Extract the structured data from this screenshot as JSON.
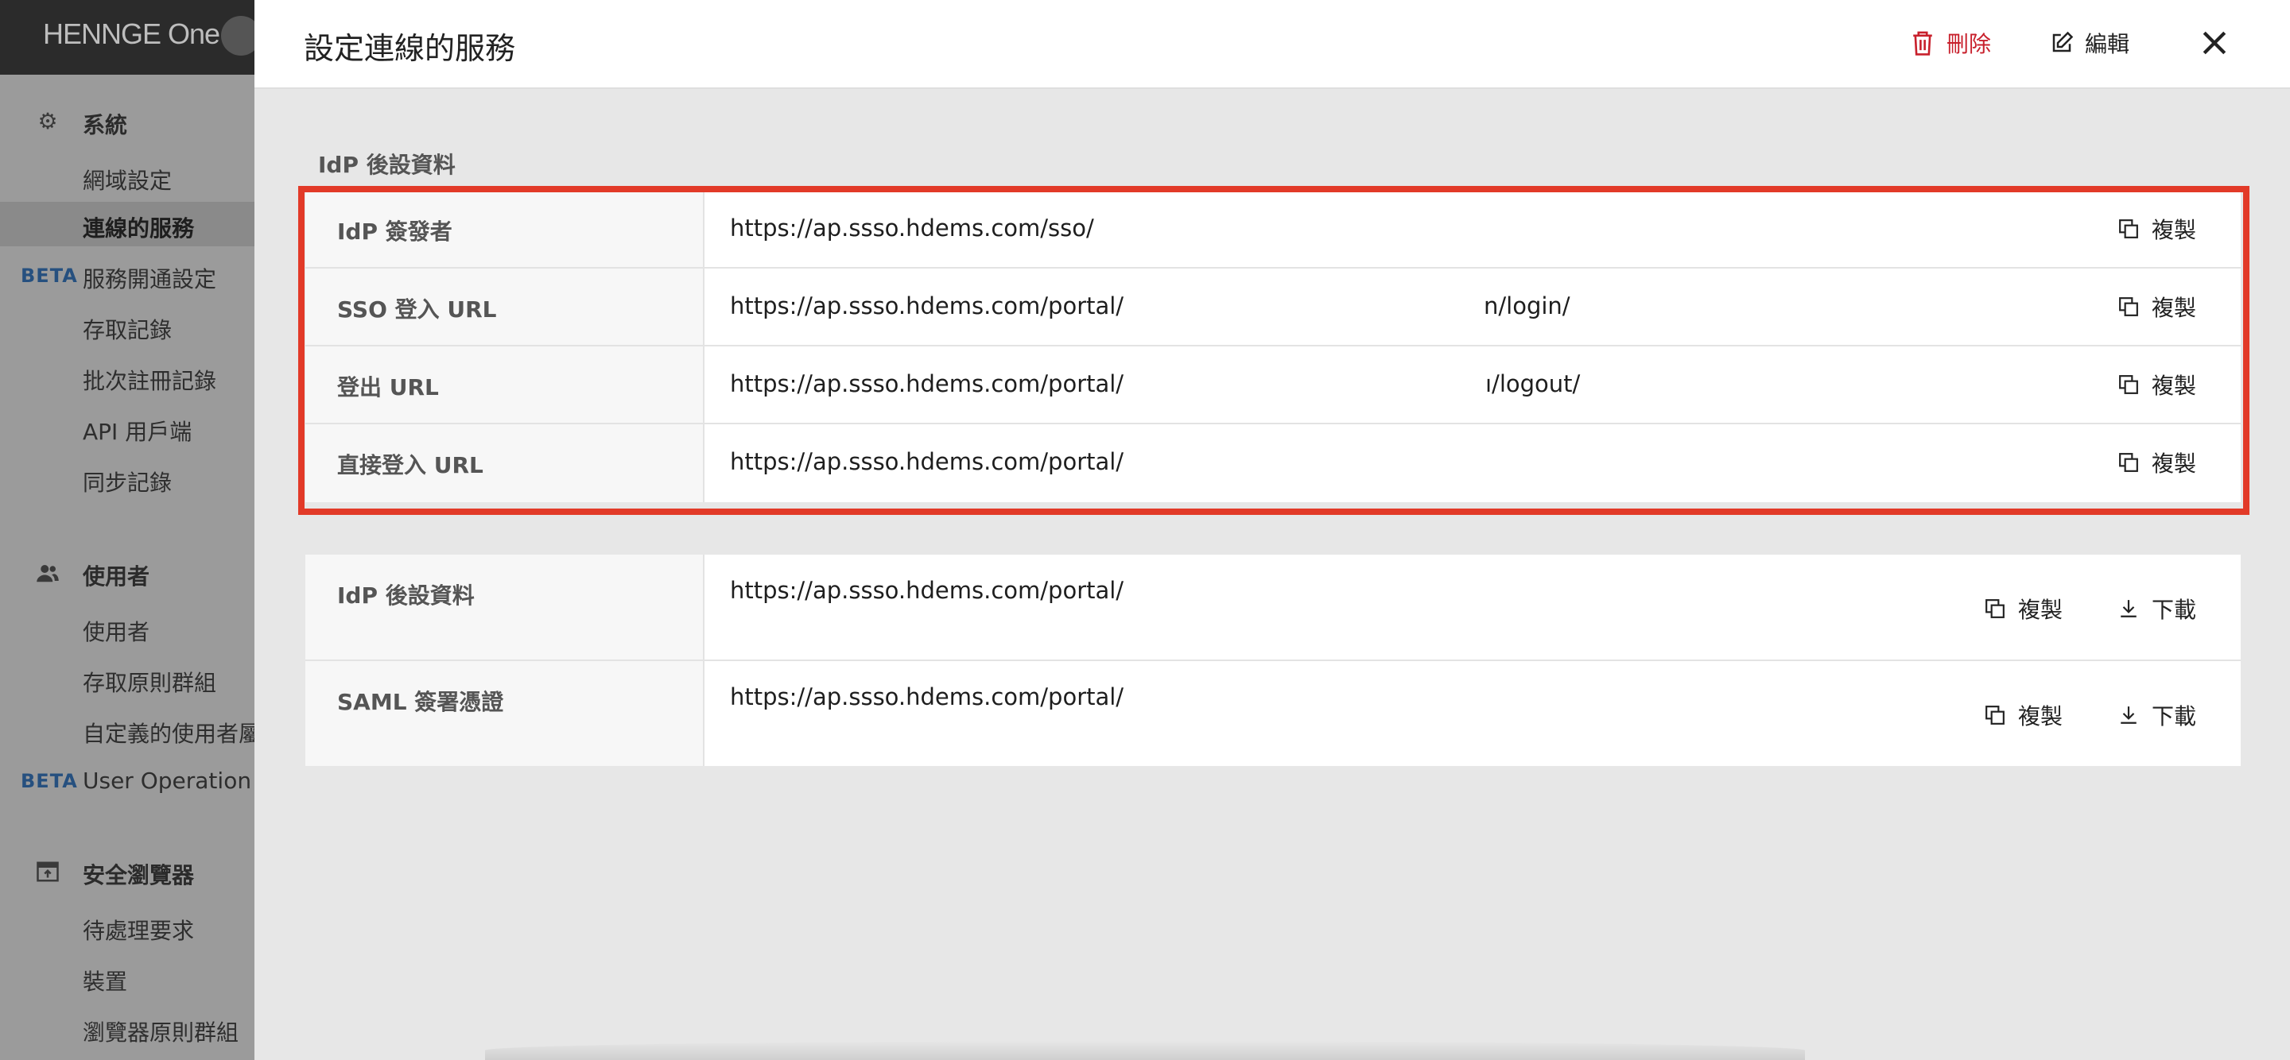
{
  "app": {
    "logo": "HENNGE One"
  },
  "sidebar": {
    "sections": [
      {
        "title": "系統",
        "icon": "gear-icon",
        "items": [
          {
            "label": "網域設定",
            "active": false,
            "beta": ""
          },
          {
            "label": "連線的服務",
            "active": true,
            "beta": ""
          },
          {
            "label": "服務開通設定",
            "active": false,
            "beta": "BETA"
          },
          {
            "label": "存取記錄",
            "active": false,
            "beta": ""
          },
          {
            "label": "批次註冊記錄",
            "active": false,
            "beta": ""
          },
          {
            "label": "API 用戶端",
            "active": false,
            "beta": ""
          },
          {
            "label": "同步記錄",
            "active": false,
            "beta": ""
          }
        ]
      },
      {
        "title": "使用者",
        "icon": "users-icon",
        "items": [
          {
            "label": "使用者",
            "active": false,
            "beta": ""
          },
          {
            "label": "存取原則群組",
            "active": false,
            "beta": ""
          },
          {
            "label": "自定義的使用者屬",
            "active": false,
            "beta": ""
          },
          {
            "label": "User Operation L",
            "active": false,
            "beta": "BETA"
          }
        ]
      },
      {
        "title": "安全瀏覽器",
        "icon": "browser-icon",
        "items": [
          {
            "label": "待處理要求",
            "active": false,
            "beta": ""
          },
          {
            "label": "裝置",
            "active": false,
            "beta": ""
          },
          {
            "label": "瀏覽器原則群組",
            "active": false,
            "beta": ""
          }
        ]
      }
    ]
  },
  "modal": {
    "title": "設定連線的服務",
    "actions": {
      "delete": "刪除",
      "edit": "編輯"
    },
    "section_label": "IdP 後設資料",
    "table1": {
      "rows": [
        {
          "key": "IdP 簽發者",
          "value": "https://ap.ssso.hdems.com/sso/",
          "copy": "複製"
        },
        {
          "key": "SSO 登入 URL",
          "value": "https://ap.ssso.hdems.com/portal/",
          "value_suffix": "n/login/",
          "copy": "複製"
        },
        {
          "key": "登出 URL",
          "value": "https://ap.ssso.hdems.com/portal/",
          "value_suffix": "ı/logout/",
          "copy": "複製"
        },
        {
          "key": "直接登入 URL",
          "value": "https://ap.ssso.hdems.com/portal/",
          "copy": "複製"
        }
      ]
    },
    "table2": {
      "rows": [
        {
          "key": "IdP 後設資料",
          "value": "https://ap.ssso.hdems.com/portal/",
          "copy": "複製",
          "download": "下載"
        },
        {
          "key": "SAML 簽署憑證",
          "value": "https://ap.ssso.hdems.com/portal/",
          "copy": "複製",
          "download": "下載"
        }
      ]
    },
    "colors": {
      "highlight": "#e23a28",
      "delete": "#c8202c",
      "beta": "#26507f"
    }
  }
}
